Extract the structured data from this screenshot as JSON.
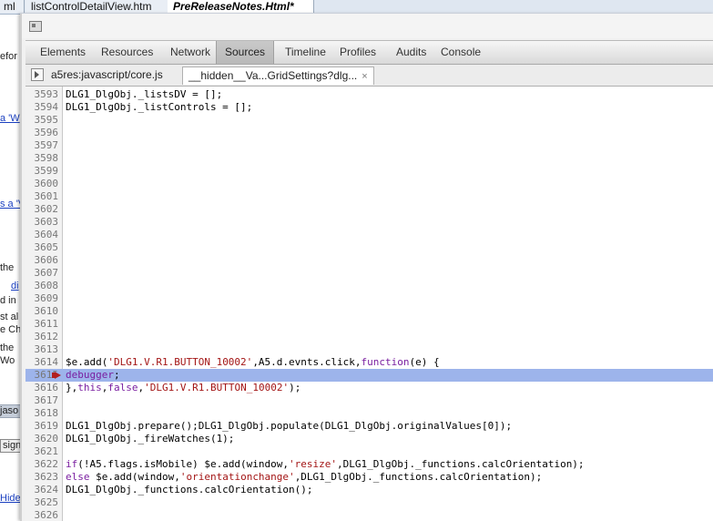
{
  "background_window": {
    "tabs": [
      {
        "label": "ml",
        "active": false
      },
      {
        "label": "listControlDetailView.htm",
        "active": false
      },
      {
        "label": "PreReleaseNotes.Html*",
        "active": true
      }
    ],
    "fragments": [
      "efor",
      "a 'W",
      "s a 'V",
      "the",
      "di",
      "d in",
      "st al",
      "e Ch",
      "the",
      "Wo",
      "jaso",
      "sign",
      "Hide"
    ]
  },
  "devtools": {
    "panel_tabs": [
      "Elements",
      "Resources",
      "Network",
      "Sources",
      "Timeline",
      "Profiles",
      "Audits",
      "Console"
    ],
    "active_panel": "Sources",
    "file_tabs": [
      {
        "label": "a5res:javascript/core.js",
        "active": false
      },
      {
        "label": "__hidden__Va...GridSettings?dlg...",
        "active": true
      }
    ],
    "close_glyph": "×",
    "code_lines": [
      {
        "num": "3593",
        "text": "DLG1_DlgObj._listsDV = [];"
      },
      {
        "num": "3594",
        "text": "DLG1_DlgObj._listControls = [];"
      },
      {
        "num": "3595",
        "text": ""
      },
      {
        "num": "3596",
        "text": ""
      },
      {
        "num": "3597",
        "text": ""
      },
      {
        "num": "3598",
        "text": ""
      },
      {
        "num": "3599",
        "text": ""
      },
      {
        "num": "3600",
        "text": ""
      },
      {
        "num": "3601",
        "text": ""
      },
      {
        "num": "3602",
        "text": ""
      },
      {
        "num": "3603",
        "text": ""
      },
      {
        "num": "3604",
        "text": ""
      },
      {
        "num": "3605",
        "text": ""
      },
      {
        "num": "3606",
        "text": ""
      },
      {
        "num": "3607",
        "text": ""
      },
      {
        "num": "3608",
        "text": ""
      },
      {
        "num": "3609",
        "text": ""
      },
      {
        "num": "3610",
        "text": ""
      },
      {
        "num": "3611",
        "text": ""
      },
      {
        "num": "3612",
        "text": ""
      },
      {
        "num": "3613",
        "text": ""
      },
      {
        "num": "3614",
        "text": "$e.add('DLG1.V.R1.BUTTON_10002',A5.d.evnts.click,function(e) {"
      },
      {
        "num": "3615",
        "text": "debugger;",
        "current": true,
        "breakpoint": true
      },
      {
        "num": "3616",
        "text": "},this,false,'DLG1.V.R1.BUTTON_10002');"
      },
      {
        "num": "3617",
        "text": ""
      },
      {
        "num": "3618",
        "text": ""
      },
      {
        "num": "3619",
        "text": "DLG1_DlgObj.prepare();DLG1_DlgObj.populate(DLG1_DlgObj.originalValues[0]);"
      },
      {
        "num": "3620",
        "text": "DLG1_DlgObj._fireWatches(1);"
      },
      {
        "num": "3621",
        "text": ""
      },
      {
        "num": "3622",
        "text": "if(!A5.flags.isMobile) $e.add(window,'resize',DLG1_DlgObj._functions.calcOrientation);"
      },
      {
        "num": "3623",
        "text": "else $e.add(window,'orientationchange',DLG1_DlgObj._functions.calcOrientation);"
      },
      {
        "num": "3624",
        "text": "DLG1_DlgObj._functions.calcOrientation();"
      },
      {
        "num": "3625",
        "text": ""
      },
      {
        "num": "3626",
        "text": ""
      }
    ]
  }
}
